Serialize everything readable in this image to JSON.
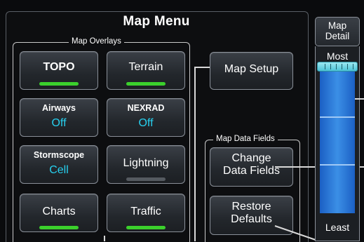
{
  "title": "Map Menu",
  "overlays": {
    "group_label": "Map Overlays",
    "buttons": {
      "topo": {
        "label": "TOPO",
        "state": "on"
      },
      "terrain": {
        "label": "Terrain",
        "state": "on"
      },
      "airways": {
        "label": "Airways",
        "value": "Off"
      },
      "nexrad": {
        "label": "NEXRAD",
        "value": "Off"
      },
      "stormscope": {
        "label": "Stormscope",
        "value": "Cell"
      },
      "lightning": {
        "label": "Lightning",
        "state": "off"
      },
      "charts": {
        "label": "Charts",
        "state": "on"
      },
      "traffic": {
        "label": "Traffic",
        "state": "on"
      }
    }
  },
  "map_setup": {
    "label": "Map Setup"
  },
  "data_fields": {
    "group_label": "Map Data Fields",
    "change_line1": "Change",
    "change_line2": "Data Fields",
    "restore_line1": "Restore",
    "restore_line2": "Defaults"
  },
  "map_detail": {
    "label_line1": "Map",
    "label_line2": "Detail",
    "most": "Most",
    "least": "Least",
    "level": "Most"
  },
  "colors": {
    "on_bar": "#3bd02c",
    "off_bar": "#555a60",
    "value_text": "#27d0ef",
    "slider_fill": "#3b8fe6"
  }
}
